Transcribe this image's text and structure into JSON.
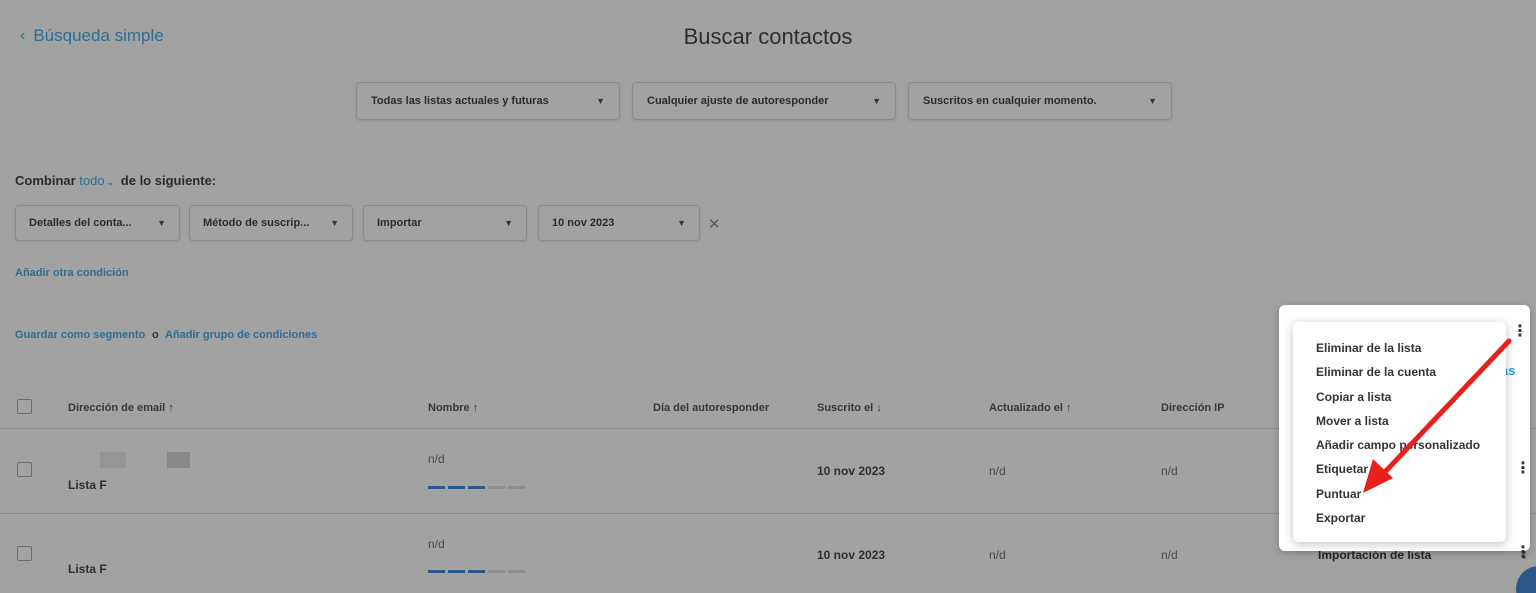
{
  "header": {
    "back_label": "Búsqueda simple",
    "title": "Buscar contactos"
  },
  "filters": {
    "lists": "Todas las listas actuales y futuras",
    "autoresponder": "Cualquier ajuste de autoresponder",
    "subscribed": "Suscritos en cualquier momento."
  },
  "combine": {
    "prefix": "Combinar",
    "mode": "todo",
    "suffix": "de lo siguiente:"
  },
  "conditions": [
    "Detalles del conta...",
    "Método de suscrip...",
    "Importar",
    "10 nov 2023"
  ],
  "links": {
    "add_condition": "Añadir otra condición",
    "save_segment": "Guardar como segmento",
    "separator": "o",
    "add_group": "Añadir grupo de condiciones"
  },
  "table": {
    "headers": {
      "email": "Dirección de email ↑",
      "name": "Nombre ↑",
      "autoresponder_day": "Día del autoresponder",
      "subscribed": "Suscrito el ↓",
      "updated": "Actualizado el ↑",
      "ip": "Dirección IP"
    },
    "rows": [
      {
        "list": "Lista F",
        "name": "n/d",
        "subscribed": "10 nov 2023",
        "updated": "n/d",
        "ip": "n/d",
        "source": ""
      },
      {
        "list": "Lista F",
        "name": "n/d",
        "subscribed": "10 nov 2023",
        "updated": "n/d",
        "ip": "n/d",
        "source": "Importación de lista"
      }
    ]
  },
  "panel_partial_text": "as",
  "actions_menu": [
    "Eliminar de la lista",
    "Eliminar de la cuenta",
    "Copiar a lista",
    "Mover a lista",
    "Añadir campo personalizado",
    "Etiquetar",
    "Puntuar",
    "Exportar"
  ],
  "colors": {
    "accent": "#1f9be0",
    "arrow": "#e8201c",
    "score_bar": "#1f6fd0"
  }
}
